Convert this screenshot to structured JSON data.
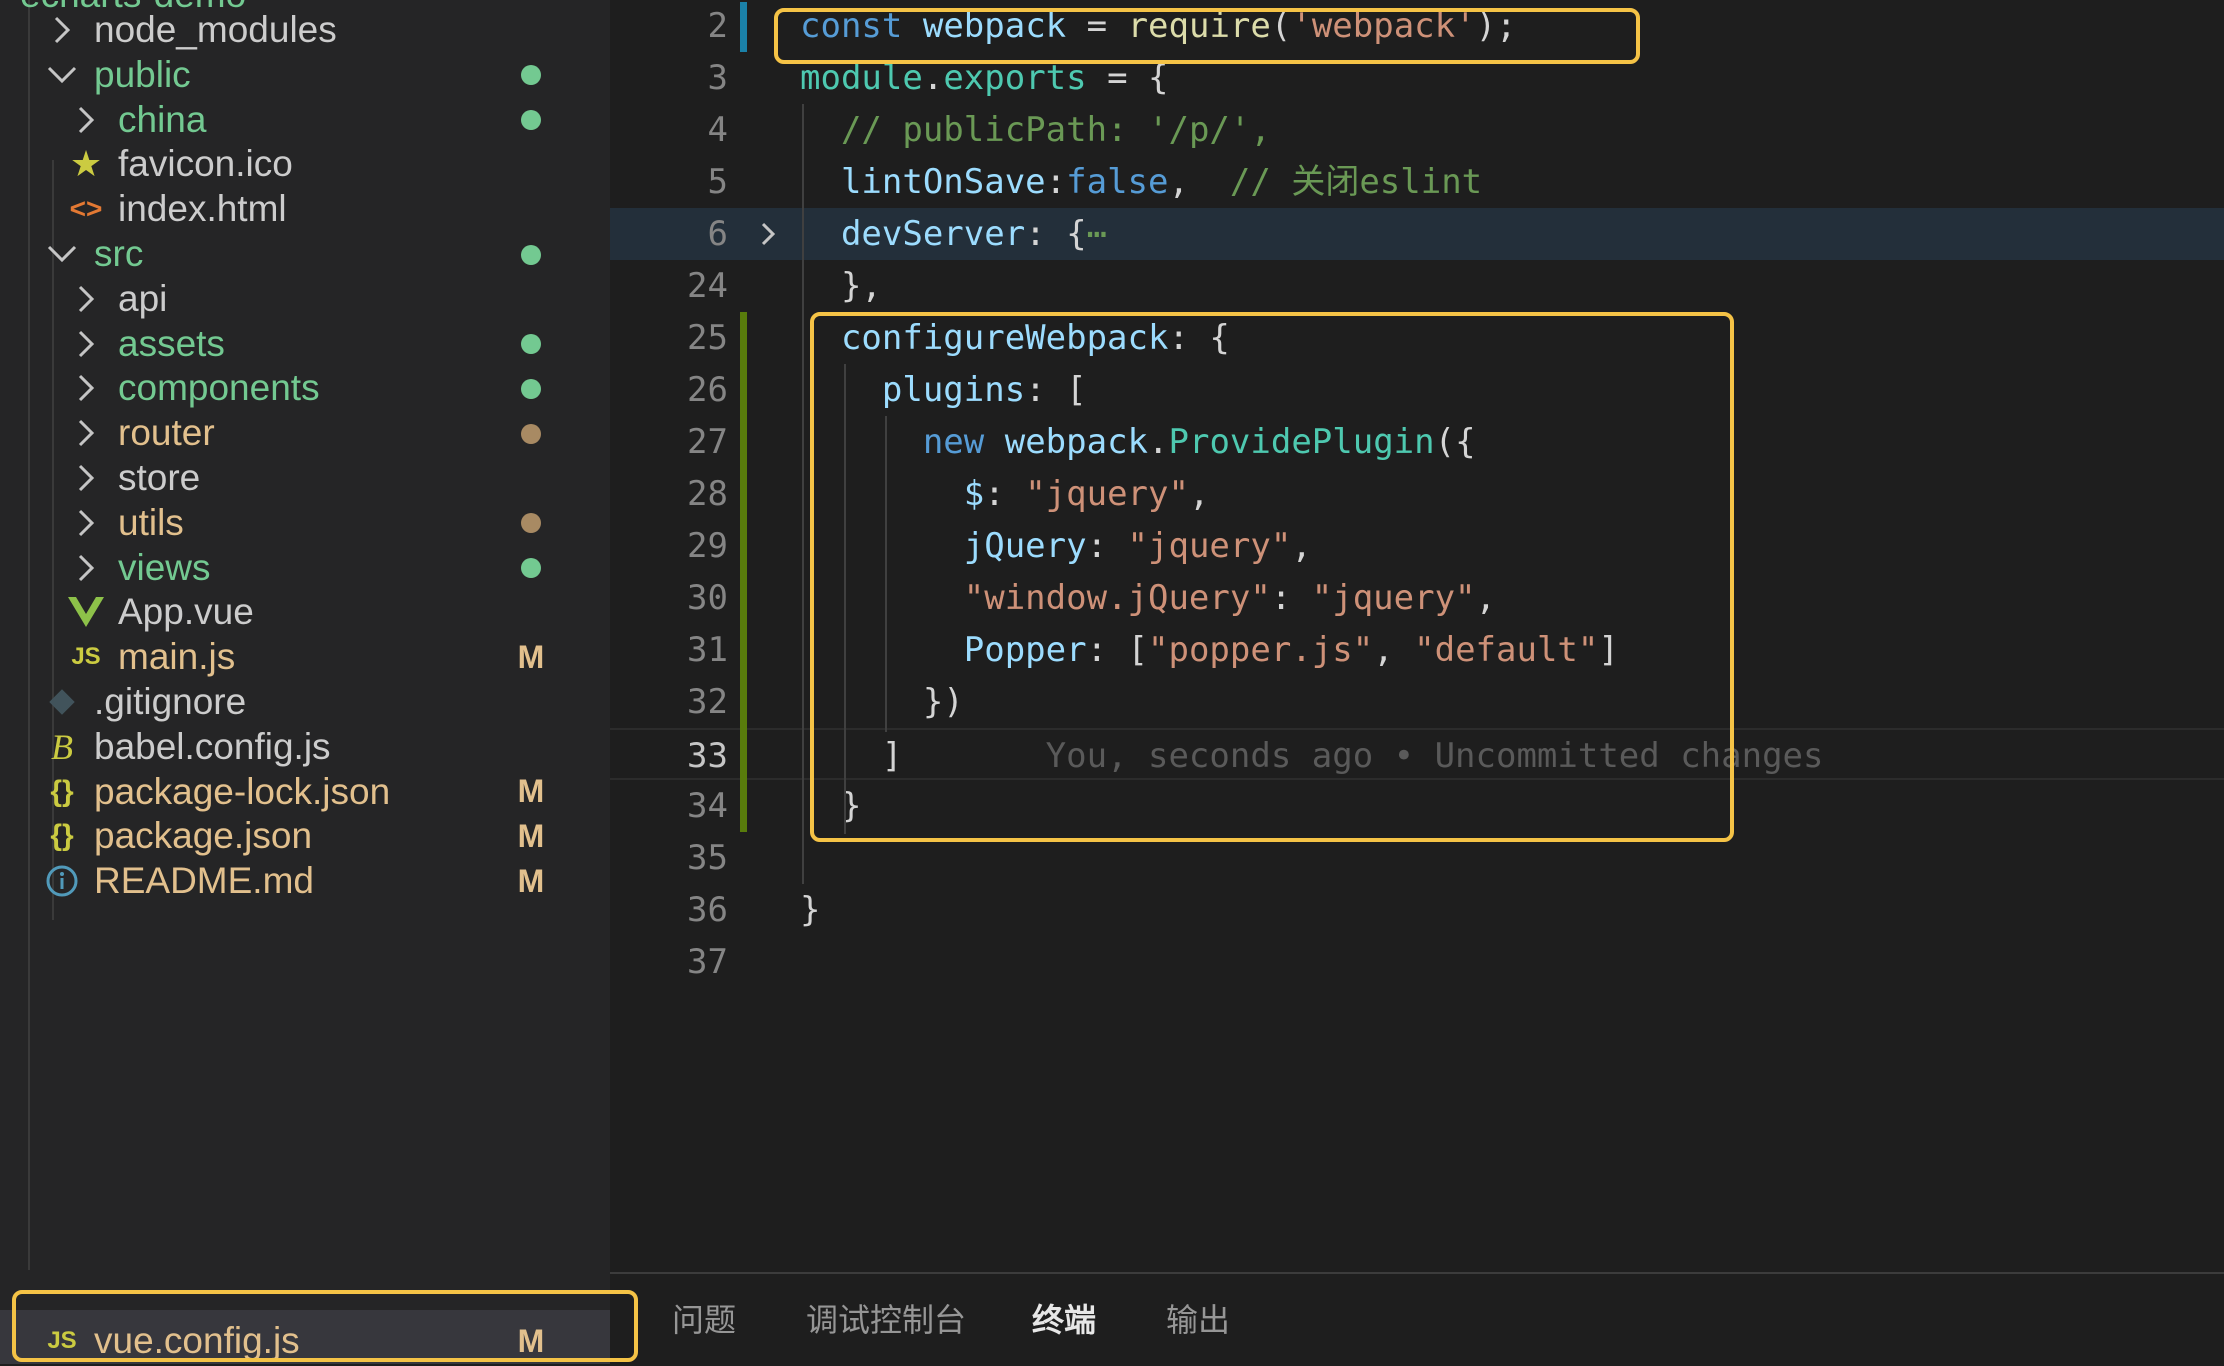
{
  "explorer": {
    "truncated_root": "echarts-demo",
    "items": [
      {
        "label": "node_modules",
        "icon": "chevron-right",
        "kind": "folder",
        "color": "#cccccc",
        "status": ""
      },
      {
        "label": "public",
        "icon": "chevron-down",
        "kind": "folder",
        "color": "#73c991",
        "status": "dot",
        "status_color": "#73c991"
      },
      {
        "label": "china",
        "icon": "chevron-right",
        "kind": "folder",
        "color": "#73c991",
        "status": "dot",
        "status_color": "#73c991"
      },
      {
        "label": "favicon.ico",
        "icon": "star",
        "kind": "file",
        "color": "#cccccc",
        "status": ""
      },
      {
        "label": "index.html",
        "icon": "html-brackets",
        "kind": "file",
        "color": "#cccccc",
        "status": ""
      },
      {
        "label": "src",
        "icon": "chevron-down",
        "kind": "folder",
        "color": "#73c991",
        "status": "dot",
        "status_color": "#73c991"
      },
      {
        "label": "api",
        "icon": "chevron-right",
        "kind": "folder",
        "color": "#cccccc",
        "status": ""
      },
      {
        "label": "assets",
        "icon": "chevron-right",
        "kind": "folder",
        "color": "#73c991",
        "status": "dot",
        "status_color": "#73c991"
      },
      {
        "label": "components",
        "icon": "chevron-right",
        "kind": "folder",
        "color": "#73c991",
        "status": "dot",
        "status_color": "#73c991"
      },
      {
        "label": "router",
        "icon": "chevron-right",
        "kind": "folder",
        "color": "#e2c08d",
        "status": "dot",
        "status_color": "#a88a63"
      },
      {
        "label": "store",
        "icon": "chevron-right",
        "kind": "folder",
        "color": "#cccccc",
        "status": ""
      },
      {
        "label": "utils",
        "icon": "chevron-right",
        "kind": "folder",
        "color": "#e2c08d",
        "status": "dot",
        "status_color": "#a88a63"
      },
      {
        "label": "views",
        "icon": "chevron-right",
        "kind": "folder",
        "color": "#73c991",
        "status": "dot",
        "status_color": "#73c991"
      },
      {
        "label": "App.vue",
        "icon": "vue-logo",
        "kind": "file",
        "color": "#cccccc",
        "status": ""
      },
      {
        "label": "main.js",
        "icon": "js",
        "kind": "file",
        "color": "#e2c08d",
        "status": "M"
      },
      {
        "label": ".gitignore",
        "icon": "git-diamond",
        "kind": "file",
        "color": "#cccccc",
        "status": ""
      },
      {
        "label": "babel.config.js",
        "icon": "babel",
        "kind": "file",
        "color": "#cccccc",
        "status": ""
      },
      {
        "label": "package-lock.json",
        "icon": "json-braces",
        "kind": "file",
        "color": "#e2c08d",
        "status": "M"
      },
      {
        "label": "package.json",
        "icon": "json-braces",
        "kind": "file",
        "color": "#e2c08d",
        "status": "M"
      },
      {
        "label": "README.md",
        "icon": "info-circle",
        "kind": "file",
        "color": "#e2c08d",
        "status": "M"
      },
      {
        "label": "vue.config.js",
        "icon": "js",
        "kind": "file",
        "color": "#e2c08d",
        "status": "M",
        "selected": true
      }
    ]
  },
  "editor": {
    "active_line": "33",
    "lines": [
      {
        "n": "2",
        "tokens": [
          [
            "k",
            "const"
          ],
          [
            "p",
            " "
          ],
          [
            "v",
            "webpack"
          ],
          [
            "p",
            " = "
          ],
          [
            "f",
            "require"
          ],
          [
            "p",
            "("
          ],
          [
            "s",
            "'webpack'"
          ],
          [
            "p",
            ");"
          ]
        ]
      },
      {
        "n": "3",
        "tokens": [
          [
            "cls",
            "module"
          ],
          [
            "p",
            "."
          ],
          [
            "cls",
            "exports"
          ],
          [
            "p",
            " = {"
          ]
        ]
      },
      {
        "n": "4",
        "tokens": [
          [
            "p",
            "  "
          ],
          [
            "cm",
            "// publicPath: '/p/',"
          ]
        ]
      },
      {
        "n": "5",
        "tokens": [
          [
            "p",
            "  "
          ],
          [
            "v",
            "lintOnSave"
          ],
          [
            "p",
            ":"
          ],
          [
            "k",
            "false"
          ],
          [
            "p",
            ",  "
          ],
          [
            "cm",
            "// 关闭eslint"
          ]
        ]
      },
      {
        "n": "6",
        "tokens": [
          [
            "p",
            "  "
          ],
          [
            "v",
            "devServer"
          ],
          [
            "p",
            ": {"
          ],
          [
            "cm",
            "⋯"
          ]
        ],
        "folded": true
      },
      {
        "n": "24",
        "tokens": [
          [
            "p",
            "  },"
          ]
        ]
      },
      {
        "n": "25",
        "tokens": [
          [
            "p",
            "  "
          ],
          [
            "v",
            "configureWebpack"
          ],
          [
            "p",
            ": {"
          ]
        ]
      },
      {
        "n": "26",
        "tokens": [
          [
            "p",
            "    "
          ],
          [
            "v",
            "plugins"
          ],
          [
            "p",
            ": ["
          ]
        ]
      },
      {
        "n": "27",
        "tokens": [
          [
            "p",
            "      "
          ],
          [
            "k",
            "new"
          ],
          [
            "p",
            " "
          ],
          [
            "v",
            "webpack"
          ],
          [
            "p",
            "."
          ],
          [
            "cls",
            "ProvidePlugin"
          ],
          [
            "p",
            "({"
          ]
        ]
      },
      {
        "n": "28",
        "tokens": [
          [
            "p",
            "        "
          ],
          [
            "v",
            "$"
          ],
          [
            "p",
            ": "
          ],
          [
            "s",
            "\"jquery\""
          ],
          [
            "p",
            ","
          ]
        ]
      },
      {
        "n": "29",
        "tokens": [
          [
            "p",
            "        "
          ],
          [
            "v",
            "jQuery"
          ],
          [
            "p",
            ": "
          ],
          [
            "s",
            "\"jquery\""
          ],
          [
            "p",
            ","
          ]
        ]
      },
      {
        "n": "30",
        "tokens": [
          [
            "p",
            "        "
          ],
          [
            "s",
            "\"window.jQuery\""
          ],
          [
            "p",
            ": "
          ],
          [
            "s",
            "\"jquery\""
          ],
          [
            "p",
            ","
          ]
        ]
      },
      {
        "n": "31",
        "tokens": [
          [
            "p",
            "        "
          ],
          [
            "v",
            "Popper"
          ],
          [
            "p",
            ": ["
          ],
          [
            "s",
            "\"popper.js\""
          ],
          [
            "p",
            ", "
          ],
          [
            "s",
            "\"default\""
          ],
          [
            "p",
            "]"
          ]
        ]
      },
      {
        "n": "32",
        "tokens": [
          [
            "p",
            "      })"
          ]
        ]
      },
      {
        "n": "33",
        "tokens": [
          [
            "p",
            "    ]"
          ],
          [
            "blame",
            "       You, seconds ago • Uncommitted changes"
          ]
        ]
      },
      {
        "n": "34",
        "tokens": [
          [
            "p",
            "  }"
          ]
        ]
      },
      {
        "n": "35",
        "tokens": []
      },
      {
        "n": "36",
        "tokens": [
          [
            "p",
            "}"
          ]
        ]
      },
      {
        "n": "37",
        "tokens": []
      }
    ]
  },
  "panel": {
    "tabs": [
      {
        "label": "问题",
        "active": false
      },
      {
        "label": "调试控制台",
        "active": false
      },
      {
        "label": "终端",
        "active": true
      },
      {
        "label": "输出",
        "active": false
      }
    ]
  },
  "colors": {
    "highlight_box": "#f5c346",
    "git_added": "#587c0c",
    "git_modified": "#1b81a8"
  }
}
